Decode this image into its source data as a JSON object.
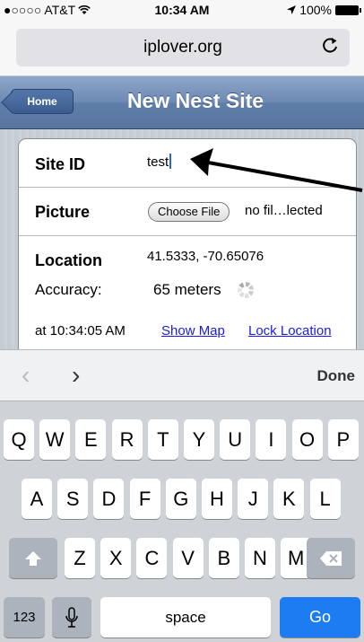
{
  "status_bar": {
    "carrier": "●○○○○ AT&T",
    "wifi_icon": "wifi-icon",
    "time": "10:34 AM",
    "location_icon": "location-arrow-icon",
    "battery": "100%"
  },
  "browser": {
    "url": "iplover.org",
    "reload_icon": "reload-icon"
  },
  "nav": {
    "back_label": "Home",
    "title": "New Nest Site"
  },
  "form": {
    "site_id_label": "Site ID",
    "site_id_value": "test",
    "picture_label": "Picture",
    "choose_file_label": "Choose File",
    "no_file_text": "no fil…lected",
    "location_label": "Location",
    "coordinates": "41.5333, -70.65076",
    "accuracy_label": "Accuracy:",
    "accuracy_value": "65 meters",
    "timestamp": "at 10:34:05 AM",
    "show_map_link": "Show Map",
    "lock_location_link": "Lock Location"
  },
  "accessory_bar": {
    "prev_icon": "chevron-left-icon",
    "next_icon": "chevron-right-icon",
    "prev_glyph": "‹",
    "next_glyph": "›",
    "done_label": "Done"
  },
  "keyboard": {
    "row1": [
      "Q",
      "W",
      "E",
      "R",
      "T",
      "Y",
      "U",
      "I",
      "O",
      "P"
    ],
    "row2": [
      "A",
      "S",
      "D",
      "F",
      "G",
      "H",
      "J",
      "K",
      "L"
    ],
    "row3": [
      "Z",
      "X",
      "C",
      "V",
      "B",
      "N",
      "M"
    ],
    "numbers_label": "123",
    "space_label": "space",
    "go_label": "Go",
    "shift_icon": "shift-icon",
    "delete_icon": "delete-icon",
    "mic_icon": "microphone-icon"
  },
  "colors": {
    "nav_bar": "#6d8ab4",
    "link": "#1a1aec",
    "go_key": "#1e7cf2",
    "caret": "#2a66d8"
  }
}
